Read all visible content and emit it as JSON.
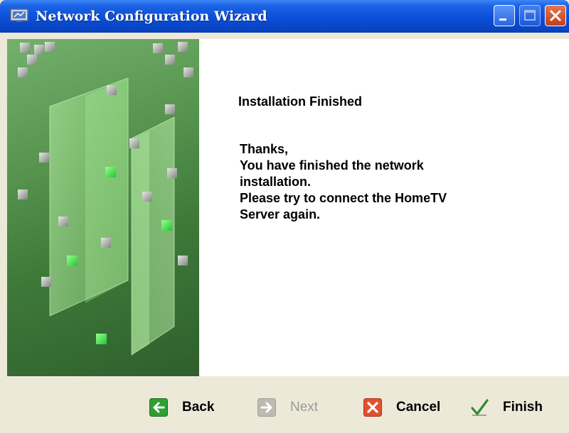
{
  "window": {
    "title": "Network Configuration Wizard"
  },
  "content": {
    "heading": "Installation Finished",
    "message_lines": [
      "Thanks,",
      "You have finished the network",
      "installation.",
      "Please try to connect  the HomeTV",
      "Server again."
    ]
  },
  "buttons": {
    "back": {
      "label": "Back",
      "icon": "arrow-left-icon",
      "color": "#2ea02e"
    },
    "next": {
      "label": "Next",
      "icon": "arrow-right-icon",
      "enabled": false
    },
    "cancel": {
      "label": "Cancel",
      "icon": "close-x-icon",
      "color": "#e2502e"
    },
    "finish": {
      "label": "Finish",
      "icon": "checkmark-icon",
      "color": "#2e8b2e"
    }
  },
  "colors": {
    "titlebar": "#0a4fd8",
    "panel_green": "#3f7a3a",
    "accent_green": "#25e63a"
  }
}
